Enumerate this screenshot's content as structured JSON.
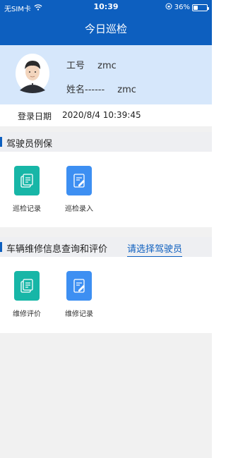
{
  "status_bar": {
    "carrier": "无SIM卡",
    "time": "10:39",
    "battery_percent": "36%",
    "battery_level": 0.36
  },
  "header": {
    "title": "今日巡检"
  },
  "profile": {
    "id_label": "工号",
    "id_value": "zmc",
    "name_label": "姓名------",
    "name_value": "zmc",
    "login_label": "登录日期",
    "login_value": "2020/8/4 10:39:45"
  },
  "section_driver": {
    "title": "驾驶员例保",
    "items": [
      {
        "label": "巡检记录",
        "icon": "records-icon",
        "color": "#17b6a7"
      },
      {
        "label": "巡检录入",
        "icon": "edit-document-icon",
        "color": "#3d8ff2"
      }
    ]
  },
  "section_vehicle": {
    "title": "车辆维修信息查询和评价",
    "select_driver": "请选择驾驶员",
    "items": [
      {
        "label": "维修评价",
        "icon": "records-icon",
        "color": "#17b6a7"
      },
      {
        "label": "维修记录",
        "icon": "edit-document-icon",
        "color": "#3d8ff2"
      }
    ]
  }
}
